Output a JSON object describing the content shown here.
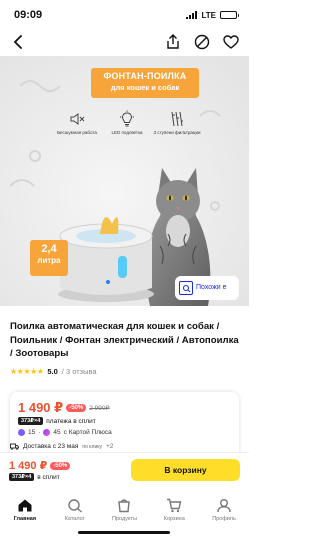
{
  "status_bar": {
    "time": "09:09",
    "network": "LTE"
  },
  "hero": {
    "banner_line1": "ФОНТАН-ПОИЛКА",
    "banner_line2": "для кошек и собак",
    "features": [
      {
        "icon": "mute-icon",
        "label": "Бесшумная работа"
      },
      {
        "icon": "bulb-icon",
        "label": "LED подсветка"
      },
      {
        "icon": "filter-icon",
        "label": "3 ступени фильтрации"
      }
    ],
    "capacity_value": "2,4",
    "capacity_unit": "литра",
    "similar_button": "Похожи е"
  },
  "product": {
    "title": "Поилка автоматическая для кошек и собак / Поильник / Фонтан электрический / Автопоилка / Зоотовары",
    "rating": "5.0",
    "reviews": "/ 3 отзыва",
    "rating_stars": 5
  },
  "price_card": {
    "price": "1 490",
    "currency": "₽",
    "discount_badge": "-50%",
    "old_price": "2 990₽",
    "split_chip": "373₽×4",
    "split_text": "платежа в сплит",
    "bonus_text": "15 · 45 с Картой Плюса",
    "bonus_a": "15",
    "bonus_b": "45",
    "bonus_card": "с Картой Плюса",
    "delivery_label": "Доставка с 23 мая",
    "delivery_small": "по клику",
    "delivery_extra": "+2"
  },
  "buy_bar": {
    "price": "1 490",
    "currency": "₽",
    "discount_badge": "-50%",
    "split_chip": "373₽×4",
    "split_text": "в сплит",
    "cart_button": "В корзину"
  },
  "tabs": [
    {
      "icon": "home-icon",
      "label": "Главная"
    },
    {
      "icon": "catalog-icon",
      "label": "Каталог"
    },
    {
      "icon": "products-icon",
      "label": "Продукты"
    },
    {
      "icon": "cart-icon",
      "label": "Корзина"
    },
    {
      "icon": "profile-icon",
      "label": "Профиль"
    }
  ],
  "colors": {
    "accent_yellow": "#ffde29",
    "price_red": "#ea5230",
    "banner_orange": "#f7a43a",
    "link_blue": "#1a2ce2",
    "star_yellow": "#ffc107"
  }
}
